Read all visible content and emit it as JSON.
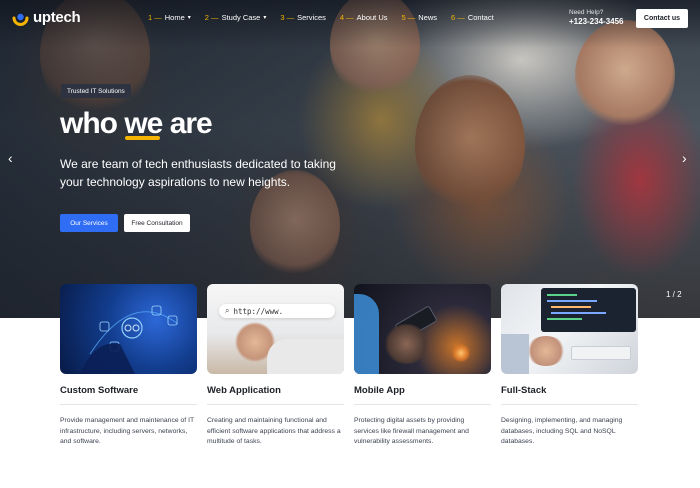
{
  "header": {
    "logo_text": "uptech",
    "nav": [
      {
        "num": "1 —",
        "label": "Home",
        "dropdown": true
      },
      {
        "num": "2 —",
        "label": "Study Case",
        "dropdown": true
      },
      {
        "num": "3 —",
        "label": "Services",
        "dropdown": false
      },
      {
        "num": "4 —",
        "label": "About Us",
        "dropdown": false
      },
      {
        "num": "5 —",
        "label": "News",
        "dropdown": false
      },
      {
        "num": "6 —",
        "label": "Contact",
        "dropdown": false
      }
    ],
    "help_label": "Need Help?",
    "help_phone": "+123-234-3456",
    "contact_button": "Contact us"
  },
  "hero": {
    "badge": "Trusted IT Solutions",
    "title_before": "who ",
    "title_highlight": "we",
    "title_after": " are",
    "description": "We are team of tech enthusiasts dedicated to taking your technology aspirations to new heights.",
    "primary_button": "Our Services",
    "secondary_button": "Free Consultation",
    "slide_counter": "1 / 2",
    "prev_icon": "chevron-left-icon",
    "next_icon": "chevron-right-icon"
  },
  "cards": [
    {
      "title": "Custom Software",
      "description": "Provide management and maintenance of IT infrastructure, including servers, networks, and software."
    },
    {
      "title": "Web Application",
      "description": "Creating and maintaining functional and efficient software applications that address a multitude of tasks.",
      "image_text": "http://www."
    },
    {
      "title": "Mobile App",
      "description": "Protecting digital assets by providing services like firewall management and vulnerability assessments."
    },
    {
      "title": "Full-Stack",
      "description": "Designing, implementing, and managing databases, including SQL and NoSQL databases."
    }
  ],
  "colors": {
    "accent_blue": "#2f6df5",
    "accent_yellow": "#f4b400",
    "text_dark": "#1c1f26"
  }
}
